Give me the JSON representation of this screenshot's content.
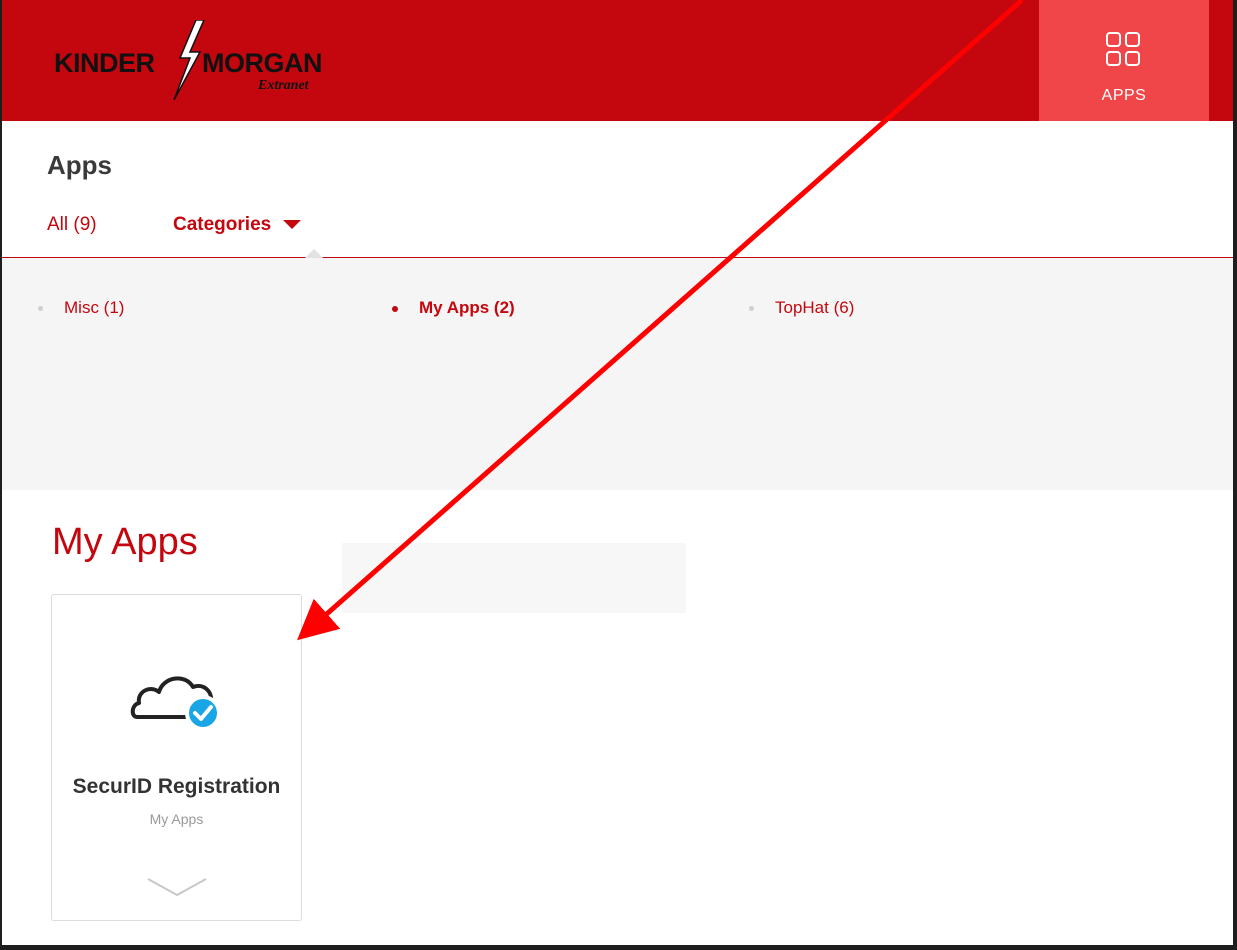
{
  "header": {
    "logo_left": "KINDER",
    "logo_right": "MORGAN",
    "logo_sub": "Extranet",
    "apps_label": "APPS"
  },
  "page": {
    "title": "Apps"
  },
  "tabs": {
    "all_label": "All (9)",
    "categories_label": "Categories"
  },
  "categories": [
    {
      "label": "Misc (1)",
      "active": false
    },
    {
      "label": "My Apps (2)",
      "active": true
    },
    {
      "label": "TopHat (6)",
      "active": false
    }
  ],
  "section": {
    "title": "My Apps"
  },
  "app_card": {
    "name": "SecurID Registration",
    "category": "My Apps",
    "icon": "cloud-check-icon"
  },
  "colors": {
    "brand_red": "#c4070f",
    "apps_button": "#f04649",
    "check_blue": "#1aa6e6",
    "annotation_arrow": "#ff0000"
  }
}
